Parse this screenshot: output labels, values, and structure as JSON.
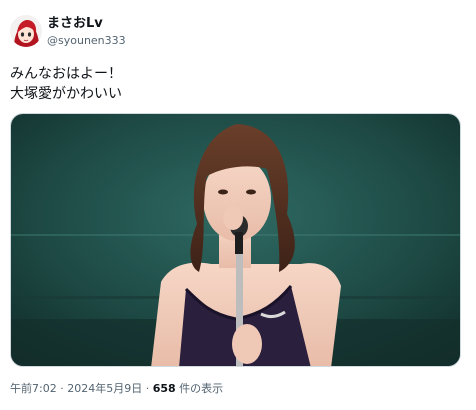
{
  "tweet": {
    "author": {
      "display_name": "まさおLv",
      "handle": "@syounen333"
    },
    "text_lines": [
      "みんなおはよー！",
      "大塚愛がかわいい"
    ],
    "meta": {
      "time": "午前7:02",
      "separator": "·",
      "date": "2024年5月9日",
      "separator2": "·",
      "views_count": "658",
      "views_label": "件の表示"
    }
  },
  "colors": {
    "text_primary": "#0f1419",
    "text_secondary": "#536471",
    "media_background": "#1f4a45"
  }
}
